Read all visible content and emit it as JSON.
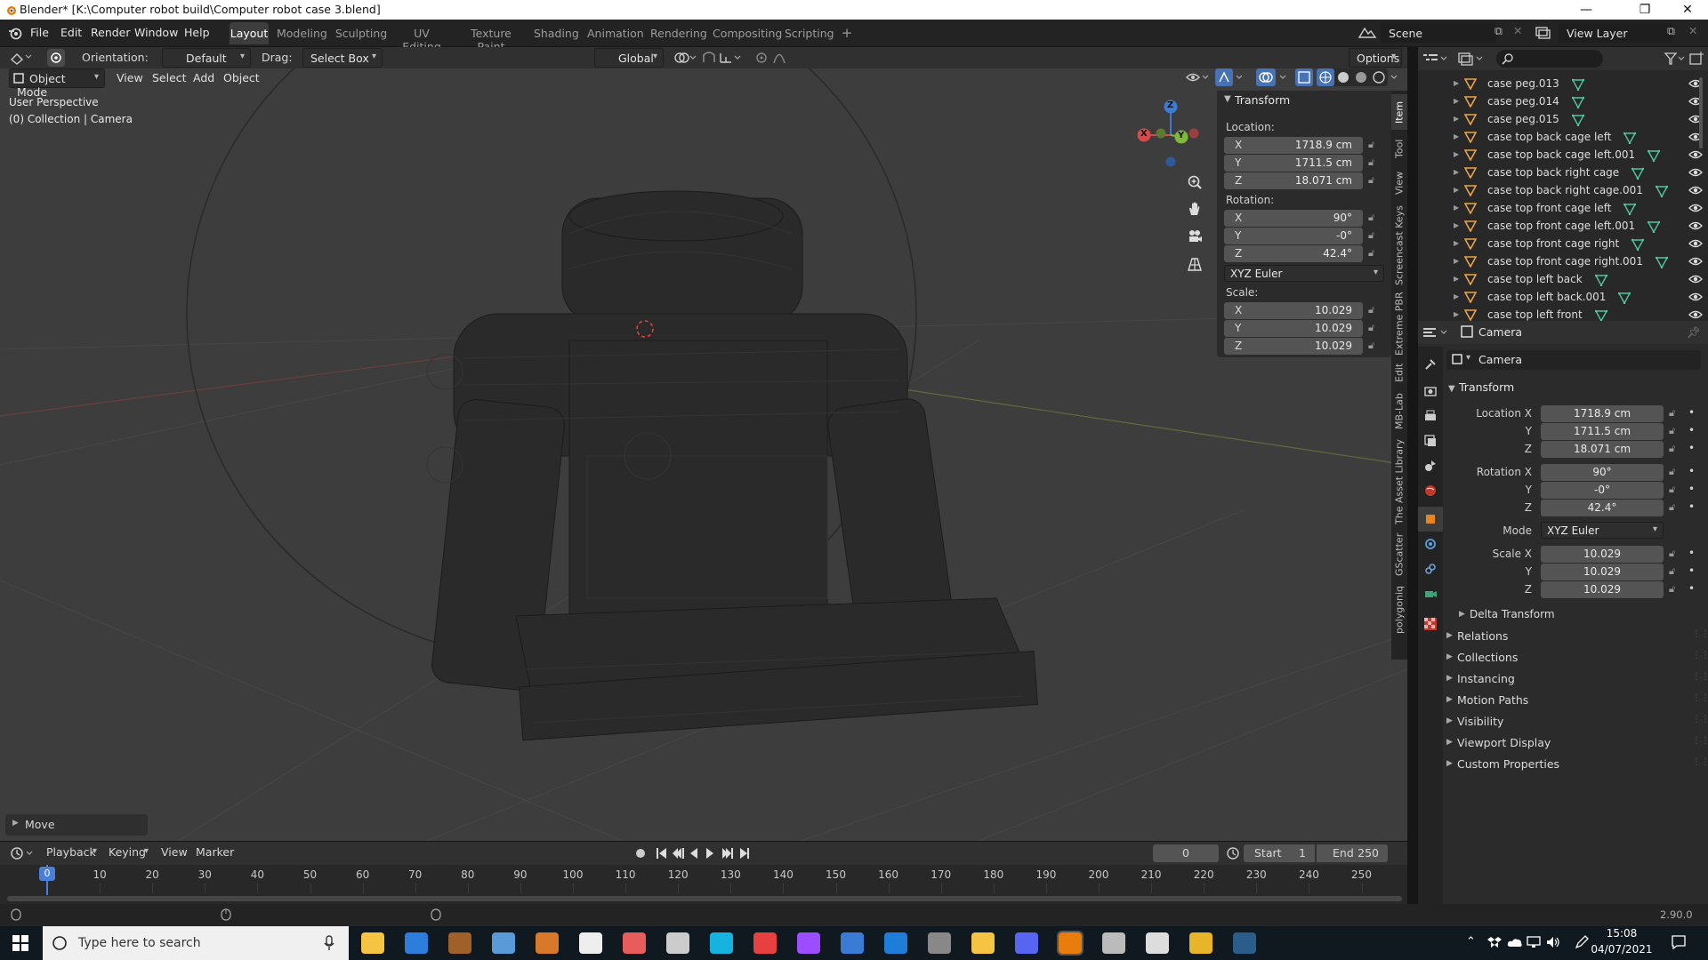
{
  "titlebar": {
    "title": "Blender* [K:\\Computer robot build\\Computer robot case 3.blend]",
    "minimize": "—",
    "maximize": "❐",
    "close": "✕"
  },
  "menu": [
    "File",
    "Edit",
    "Render",
    "Window",
    "Help"
  ],
  "workspaces": [
    "Layout",
    "Modeling",
    "Sculpting",
    "UV Editing",
    "Texture Paint",
    "Shading",
    "Animation",
    "Rendering",
    "Compositing",
    "Scripting"
  ],
  "add_workspace": "+",
  "scene": {
    "label": "Scene",
    "view_layer": "View Layer"
  },
  "toolbar": {
    "orientation_label": "Orientation:",
    "orientation_value": "Default",
    "drag_label": "Drag:",
    "drag_value": "Select Box",
    "transform_orientation": "Global",
    "options": "Options"
  },
  "viewport": {
    "mode": "Object Mode",
    "menus": [
      "View",
      "Select",
      "Add",
      "Object"
    ],
    "overlay_title": "User Perspective",
    "overlay_sub": "(0) Collection | Camera",
    "last_op": "Move",
    "gizmo_axes": [
      "X",
      "Y",
      "Z"
    ]
  },
  "npanel": {
    "section": "Transform",
    "location_label": "Location:",
    "location": [
      {
        "ax": "X",
        "v": "1718.9 cm"
      },
      {
        "ax": "Y",
        "v": "1711.5 cm"
      },
      {
        "ax": "Z",
        "v": "18.071 cm"
      }
    ],
    "rotation_label": "Rotation:",
    "rotation": [
      {
        "ax": "X",
        "v": "90°"
      },
      {
        "ax": "Y",
        "v": "-0°"
      },
      {
        "ax": "Z",
        "v": "42.4°"
      }
    ],
    "rotation_mode": "XYZ Euler",
    "scale_label": "Scale:",
    "scale": [
      {
        "ax": "X",
        "v": "10.029"
      },
      {
        "ax": "Y",
        "v": "10.029"
      },
      {
        "ax": "Z",
        "v": "10.029"
      }
    ]
  },
  "side_tabs": [
    "Item",
    "Tool",
    "View",
    "Screencast Keys",
    "Extreme PBR",
    "Edit",
    "MB-Lab",
    "The Asset Library",
    "GScatter",
    "polygoniq"
  ],
  "outliner": {
    "items": [
      "case peg.013",
      "case peg.014",
      "case peg.015",
      "case top back cage left",
      "case top back cage left.001",
      "case top back right cage",
      "case top back right cage.001",
      "case top front cage left",
      "case top front cage left.001",
      "case top front cage right",
      "case top front cage right.001",
      "case top left back",
      "case top left back.001",
      "case top left front"
    ]
  },
  "properties": {
    "object_name": "Camera",
    "datablock": "Camera",
    "section": "Transform",
    "location_label": "Location X",
    "location": [
      "1718.9 cm",
      "1711.5 cm",
      "18.071 cm"
    ],
    "rotation_label": "Rotation X",
    "rotation": [
      "90°",
      "-0°",
      "42.4°"
    ],
    "mode_label": "Mode",
    "mode": "XYZ Euler",
    "scale_label": "Scale X",
    "scale": [
      "10.029",
      "10.029",
      "10.029"
    ],
    "axis_y": "Y",
    "axis_z": "Z",
    "subsections": [
      "Delta Transform"
    ],
    "panels": [
      "Relations",
      "Collections",
      "Instancing",
      "Motion Paths",
      "Visibility",
      "Viewport Display",
      "Custom Properties"
    ]
  },
  "timeline": {
    "menus": [
      "Playback",
      "Keying",
      "View",
      "Marker"
    ],
    "current_frame": "0",
    "start_label": "Start",
    "start": "1",
    "end_label": "End",
    "end": "250",
    "ticks": [
      "0",
      "10",
      "20",
      "30",
      "40",
      "50",
      "60",
      "70",
      "80",
      "90",
      "100",
      "110",
      "120",
      "130",
      "140",
      "150",
      "160",
      "170",
      "180",
      "190",
      "200",
      "210",
      "220",
      "230",
      "240",
      "250"
    ]
  },
  "statusbar": {
    "version": "2.90.0"
  },
  "taskbar": {
    "search_placeholder": "Type here to search",
    "time": "15:08",
    "date": "04/07/2021"
  }
}
